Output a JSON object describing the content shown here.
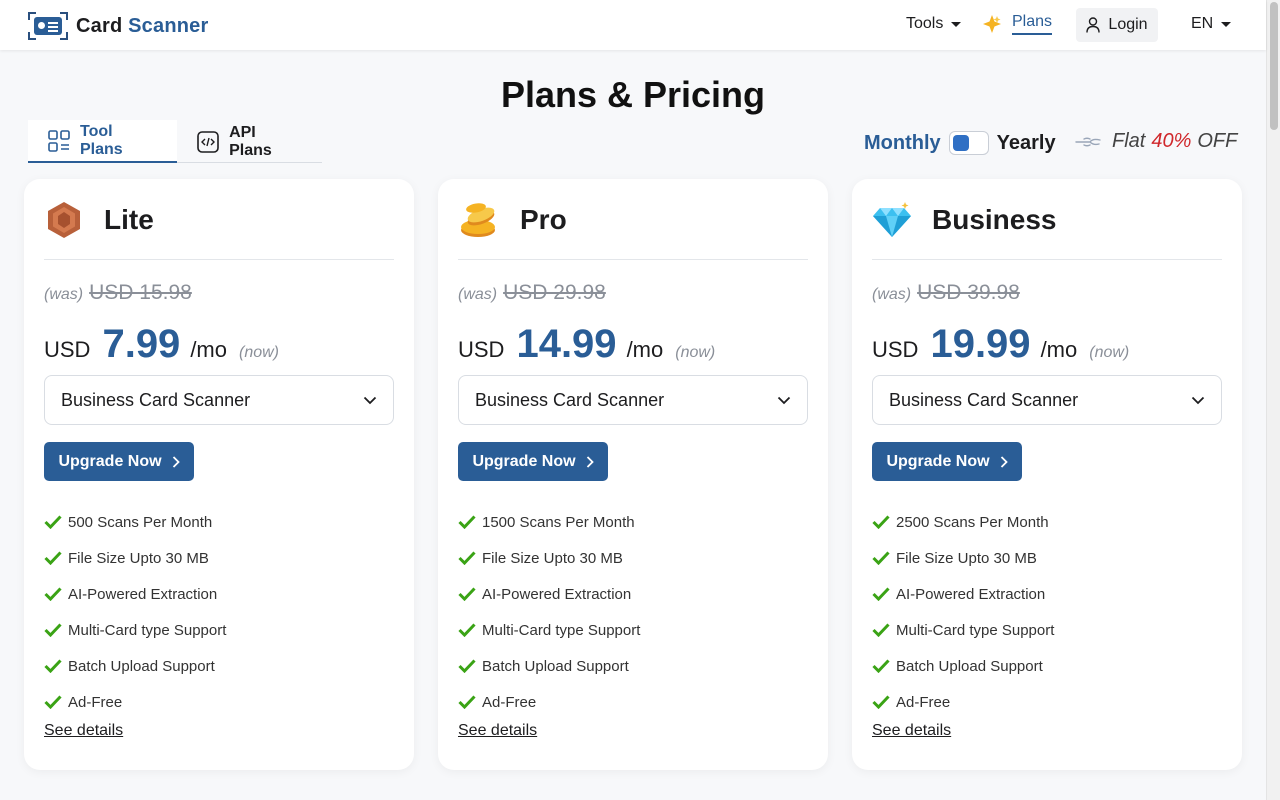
{
  "header": {
    "logo_word1": "Card",
    "logo_word2": "Scanner",
    "nav": {
      "tools_label": "Tools",
      "plans_label": "Plans",
      "login_label": "Login",
      "lang_label": "EN"
    }
  },
  "page": {
    "title": "Plans & Pricing"
  },
  "tabs": [
    {
      "label": "Tool Plans",
      "active": true,
      "icon": "grid-icon"
    },
    {
      "label": "API Plans",
      "active": false,
      "icon": "code-icon"
    }
  ],
  "billing": {
    "monthly_label": "Monthly",
    "yearly_label": "Yearly",
    "selected": "Monthly",
    "offer_prefix": "Flat",
    "offer_percent": "40%",
    "offer_suffix": "OFF",
    "offer_color": "#d0272b"
  },
  "colors": {
    "brand": "#2a5d96",
    "check": "#3aa315"
  },
  "plans": [
    {
      "name": "Lite",
      "icon": "bronze-hexagon-icon",
      "was_label": "(was)",
      "old_price": "USD 15.98",
      "currency": "USD",
      "price": "7.99",
      "per": "/mo",
      "now_label": "(now)",
      "product": "Business Card Scanner",
      "cta": "Upgrade Now",
      "features": [
        "500 Scans Per Month",
        "File Size Upto 30 MB",
        "AI-Powered Extraction",
        "Multi-Card type Support",
        "Batch Upload Support",
        "Ad-Free"
      ],
      "details_link": "See details"
    },
    {
      "name": "Pro",
      "icon": "gold-coins-icon",
      "was_label": "(was)",
      "old_price": "USD 29.98",
      "currency": "USD",
      "price": "14.99",
      "per": "/mo",
      "now_label": "(now)",
      "product": "Business Card Scanner",
      "cta": "Upgrade Now",
      "features": [
        "1500 Scans Per Month",
        "File Size Upto 30 MB",
        "AI-Powered Extraction",
        "Multi-Card type Support",
        "Batch Upload Support",
        "Ad-Free"
      ],
      "details_link": "See details"
    },
    {
      "name": "Business",
      "icon": "diamond-icon",
      "was_label": "(was)",
      "old_price": "USD 39.98",
      "currency": "USD",
      "price": "19.99",
      "per": "/mo",
      "now_label": "(now)",
      "product": "Business Card Scanner",
      "cta": "Upgrade Now",
      "features": [
        "2500 Scans Per Month",
        "File Size Upto 30 MB",
        "AI-Powered Extraction",
        "Multi-Card type Support",
        "Batch Upload Support",
        "Ad-Free"
      ],
      "details_link": "See details"
    }
  ]
}
